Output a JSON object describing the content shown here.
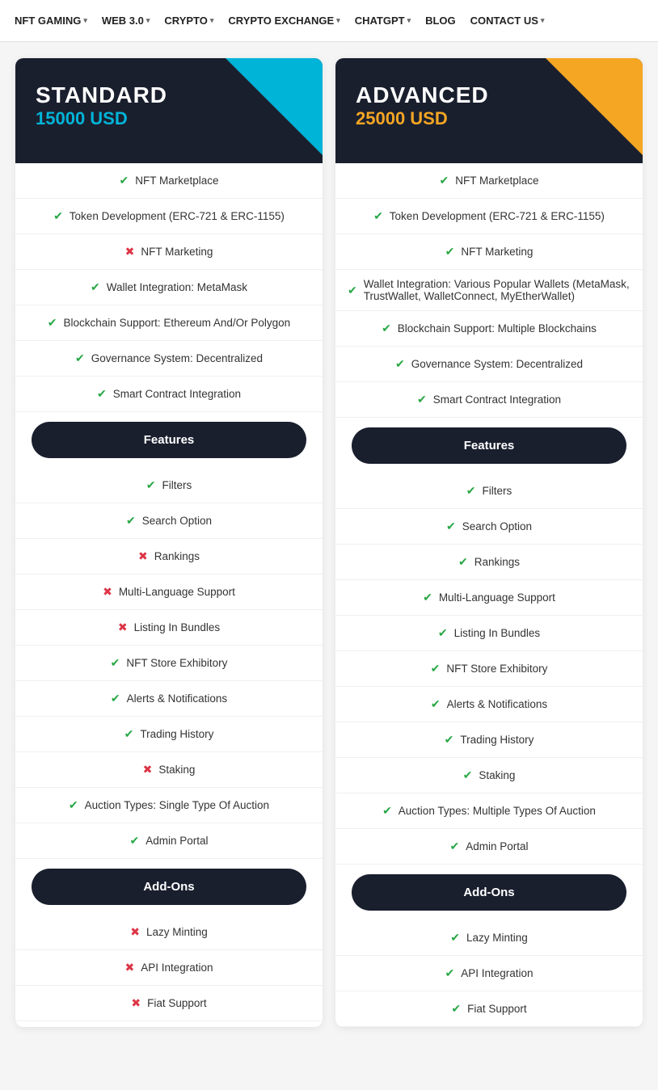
{
  "nav": {
    "items": [
      {
        "label": "NFT GAMING",
        "hasDropdown": true
      },
      {
        "label": "WEB 3.0",
        "hasDropdown": true
      },
      {
        "label": "CRYPTO",
        "hasDropdown": true
      },
      {
        "label": "CRYPTO EXCHANGE",
        "hasDropdown": true
      },
      {
        "label": "CHATGPT",
        "hasDropdown": true
      },
      {
        "label": "BLOG",
        "hasDropdown": false
      },
      {
        "label": "CONTACT US",
        "hasDropdown": true
      }
    ]
  },
  "plans": [
    {
      "id": "standard",
      "name": "STANDARD",
      "price": "15000 USD",
      "priceClass": "standard-price",
      "triangleClass": "standard-triangle",
      "coreFeatures": [
        {
          "text": "NFT Marketplace",
          "included": true
        },
        {
          "text": "Token Development (ERC-721 & ERC-1155)",
          "included": true
        },
        {
          "text": "NFT Marketing",
          "included": false
        },
        {
          "text": "Wallet Integration: MetaMask",
          "included": true
        },
        {
          "text": "Blockchain Support: Ethereum And/Or Polygon",
          "included": true
        },
        {
          "text": "Governance System: Decentralized",
          "included": true
        },
        {
          "text": "Smart Contract Integration",
          "included": true
        }
      ],
      "featuresBtn": "Features",
      "features": [
        {
          "text": "Filters",
          "included": true
        },
        {
          "text": "Search Option",
          "included": true
        },
        {
          "text": "Rankings",
          "included": false
        },
        {
          "text": "Multi-Language Support",
          "included": false
        },
        {
          "text": "Listing In Bundles",
          "included": false
        },
        {
          "text": "NFT Store Exhibitory",
          "included": true
        },
        {
          "text": "Alerts & Notifications",
          "included": true
        },
        {
          "text": "Trading History",
          "included": true
        },
        {
          "text": "Staking",
          "included": false
        },
        {
          "text": "Auction Types: Single Type Of Auction",
          "included": true
        },
        {
          "text": "Admin Portal",
          "included": true
        }
      ],
      "addOnsBtn": "Add-Ons",
      "addOns": [
        {
          "text": "Lazy Minting",
          "included": false
        },
        {
          "text": "API Integration",
          "included": false
        },
        {
          "text": "Fiat Support",
          "included": false
        }
      ]
    },
    {
      "id": "advanced",
      "name": "ADVANCED",
      "price": "25000 USD",
      "priceClass": "advanced-price",
      "triangleClass": "advanced-triangle",
      "coreFeatures": [
        {
          "text": "NFT Marketplace",
          "included": true
        },
        {
          "text": "Token Development (ERC-721 & ERC-1155)",
          "included": true
        },
        {
          "text": "NFT Marketing",
          "included": true
        },
        {
          "text": "Wallet Integration: Various Popular Wallets (MetaMask, TrustWallet, WalletConnect, MyEtherWallet)",
          "included": true
        },
        {
          "text": "Blockchain Support: Multiple Blockchains",
          "included": true
        },
        {
          "text": "Governance System: Decentralized",
          "included": true
        },
        {
          "text": "Smart Contract Integration",
          "included": true
        }
      ],
      "featuresBtn": "Features",
      "features": [
        {
          "text": "Filters",
          "included": true
        },
        {
          "text": "Search Option",
          "included": true
        },
        {
          "text": "Rankings",
          "included": true
        },
        {
          "text": "Multi-Language Support",
          "included": true
        },
        {
          "text": "Listing In Bundles",
          "included": true
        },
        {
          "text": "NFT Store Exhibitory",
          "included": true
        },
        {
          "text": "Alerts & Notifications",
          "included": true
        },
        {
          "text": "Trading History",
          "included": true
        },
        {
          "text": "Staking",
          "included": true
        },
        {
          "text": "Auction Types: Multiple Types Of Auction",
          "included": true
        },
        {
          "text": "Admin Portal",
          "included": true
        }
      ],
      "addOnsBtn": "Add-Ons",
      "addOns": [
        {
          "text": "Lazy Minting",
          "included": true
        },
        {
          "text": "API Integration",
          "included": true
        },
        {
          "text": "Fiat Support",
          "included": true
        }
      ]
    }
  ]
}
